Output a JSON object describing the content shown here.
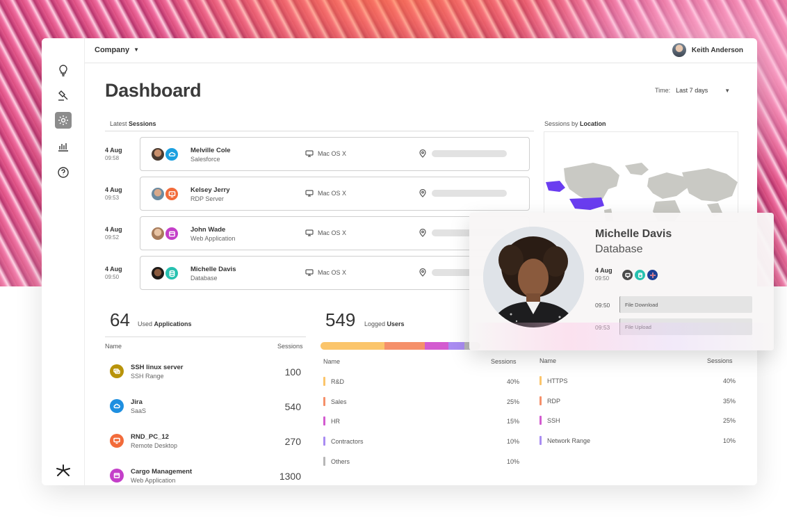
{
  "topbar": {
    "company": "Company",
    "user_name": "Keith Anderson"
  },
  "page": {
    "title": "Dashboard",
    "time_label": "Time:",
    "time_value": "Last 7 days"
  },
  "sessions": {
    "label_prefix": "Latest ",
    "label_bold": "Sessions",
    "rows": [
      {
        "date": "4 Aug",
        "time": "09:58",
        "name": "Melville Cole",
        "app": "Salesforce",
        "os": "Mac OS X"
      },
      {
        "date": "4 Aug",
        "time": "09:53",
        "name": "Kelsey Jerry",
        "app": "RDP Server",
        "os": "Mac OS X"
      },
      {
        "date": "4 Aug",
        "time": "09:52",
        "name": "John Wade",
        "app": "Web Application",
        "os": "Mac OS X"
      },
      {
        "date": "4 Aug",
        "time": "09:50",
        "name": "Michelle Davis",
        "app": "Database",
        "os": "Mac OS X"
      }
    ]
  },
  "location": {
    "label_prefix": "Sessions by ",
    "label_bold": "Location"
  },
  "applications": {
    "count": "64",
    "label_prefix": "Used ",
    "label_bold": "Applications",
    "col_name": "Name",
    "col_sessions": "Sessions",
    "rows": [
      {
        "name": "SSH linux server",
        "type": "SSH Range",
        "sessions": "100",
        "color": "#b8930a"
      },
      {
        "name": "Jira",
        "type": "SaaS",
        "sessions": "540",
        "color": "#1e8fe0"
      },
      {
        "name": "RND_PC_12",
        "type": "Remote Desktop",
        "sessions": "270",
        "color": "#f26b3a"
      },
      {
        "name": "Cargo Management",
        "type": "Web Application",
        "sessions": "1300",
        "color": "#c43fc9"
      }
    ]
  },
  "users": {
    "count": "549",
    "label_prefix": "Logged ",
    "label_bold": "Users",
    "col_name": "Name",
    "col_sessions": "Sessions",
    "departments": [
      {
        "name": "R&D",
        "value": "40%",
        "pct": 40,
        "color": "#fbc56b"
      },
      {
        "name": "Sales",
        "value": "25%",
        "pct": 25,
        "color": "#f5906a"
      },
      {
        "name": "HR",
        "value": "15%",
        "pct": 15,
        "color": "#d35bd0"
      },
      {
        "name": "Contractors",
        "value": "10%",
        "pct": 10,
        "color": "#a98cf2"
      },
      {
        "name": "Others",
        "value": "10%",
        "pct": 10,
        "color": "#b7b7b7"
      }
    ],
    "protocols": [
      {
        "name": "HTTPS",
        "value": "40%",
        "color": "#fbc56b"
      },
      {
        "name": "RDP",
        "value": "35%",
        "color": "#f5906a"
      },
      {
        "name": "SSH",
        "value": "25%",
        "color": "#d35bd0"
      },
      {
        "name": "Network Range",
        "value": "10%",
        "color": "#a98cf2"
      }
    ]
  },
  "profile": {
    "name": "Michelle Davis",
    "app": "Database",
    "date": "4 Aug",
    "time": "09:50",
    "events": [
      {
        "time": "09:50",
        "label": "File Download"
      },
      {
        "time": "09:53",
        "label": "File Upload"
      }
    ]
  },
  "colors": {
    "map_highlight": "#6a3df0",
    "map_land": "#c9c9c4",
    "salesforce": "#1ca0e0",
    "rdp": "#f26b3a",
    "webapp": "#c43fc9",
    "database": "#27c1b0"
  }
}
